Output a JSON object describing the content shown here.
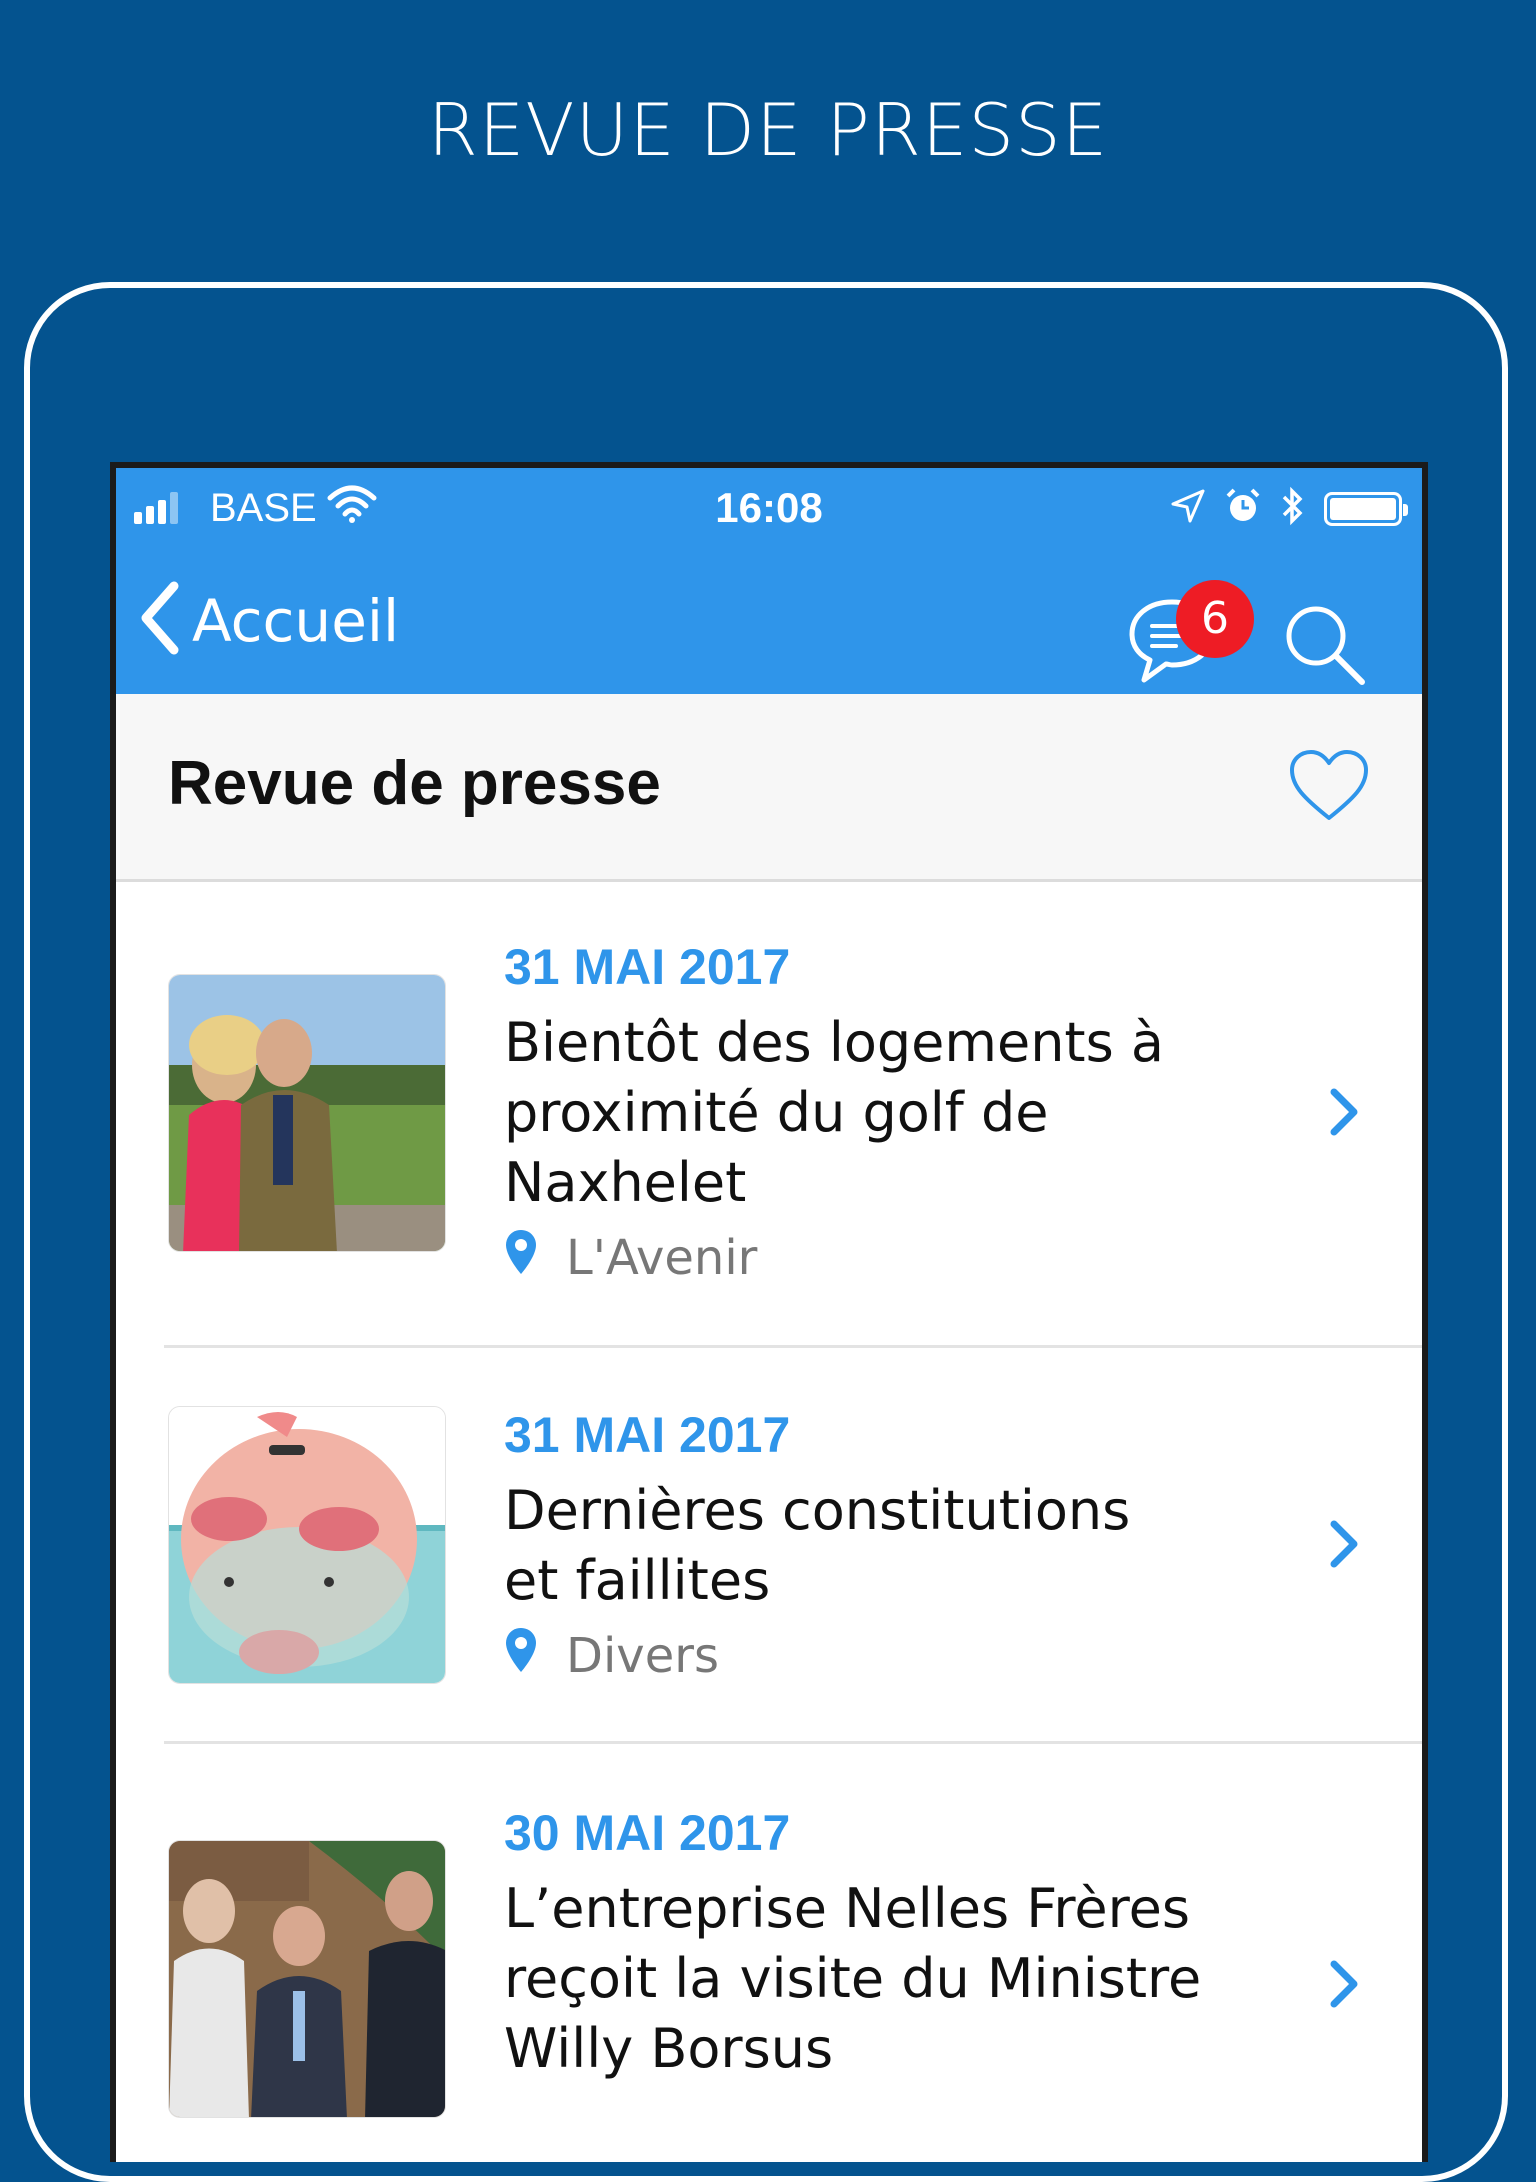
{
  "promo": {
    "title": "REVUE DE PRESSE"
  },
  "status_bar": {
    "carrier": "BASE",
    "time": "16:08",
    "icons": [
      "signal-icon",
      "wifi-icon",
      "location-arrow-icon",
      "alarm-icon",
      "bluetooth-icon",
      "battery-icon"
    ]
  },
  "nav": {
    "back_label": "Accueil",
    "badge_count": "6",
    "accent_color": "#2f95ea",
    "badge_color": "#ee1c25"
  },
  "section": {
    "title": "Revue de presse"
  },
  "articles": [
    {
      "date": "31 MAI 2017",
      "title": "Bientôt des logements à proximité du golf de Naxhelet",
      "source": "L'Avenir"
    },
    {
      "date": "31 MAI 2017",
      "title": "Dernières constitutions et faillites",
      "source": "Divers"
    },
    {
      "date": "30 MAI 2017",
      "title": "L’entreprise Nelles Frères reçoit la visite du Ministre Willy Borsus",
      "source": ""
    }
  ]
}
